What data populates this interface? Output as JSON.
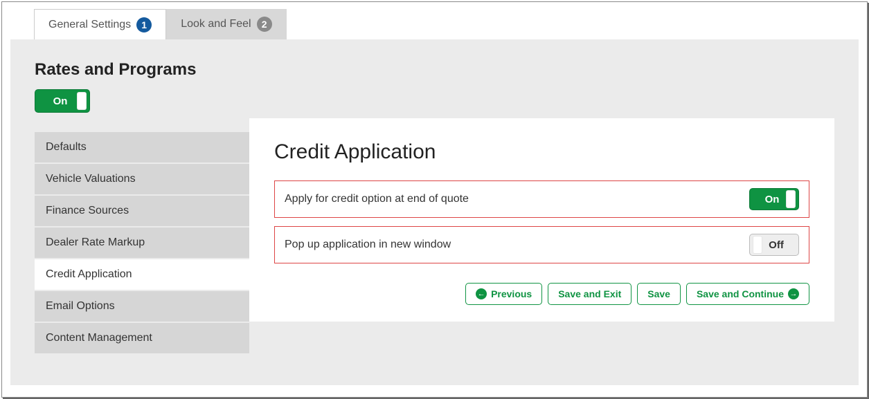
{
  "tabs": [
    {
      "label": "General Settings",
      "badge": "1",
      "active": true
    },
    {
      "label": "Look and Feel",
      "badge": "2",
      "active": false
    }
  ],
  "section": {
    "title": "Rates and Programs",
    "toggle": "On"
  },
  "sidebar": {
    "items": [
      {
        "label": "Defaults"
      },
      {
        "label": "Vehicle Valuations"
      },
      {
        "label": "Finance Sources"
      },
      {
        "label": "Dealer Rate Markup"
      },
      {
        "label": "Credit Application"
      },
      {
        "label": "Email Options"
      },
      {
        "label": "Content Management"
      }
    ],
    "activeIndex": 4
  },
  "panel": {
    "title": "Credit Application",
    "settings": [
      {
        "label": "Apply for credit option at end of quote",
        "state": "On"
      },
      {
        "label": "Pop up application in new window",
        "state": "Off"
      }
    ]
  },
  "buttons": {
    "previous": "Previous",
    "saveExit": "Save and Exit",
    "save": "Save",
    "saveContinue": "Save and Continue"
  }
}
